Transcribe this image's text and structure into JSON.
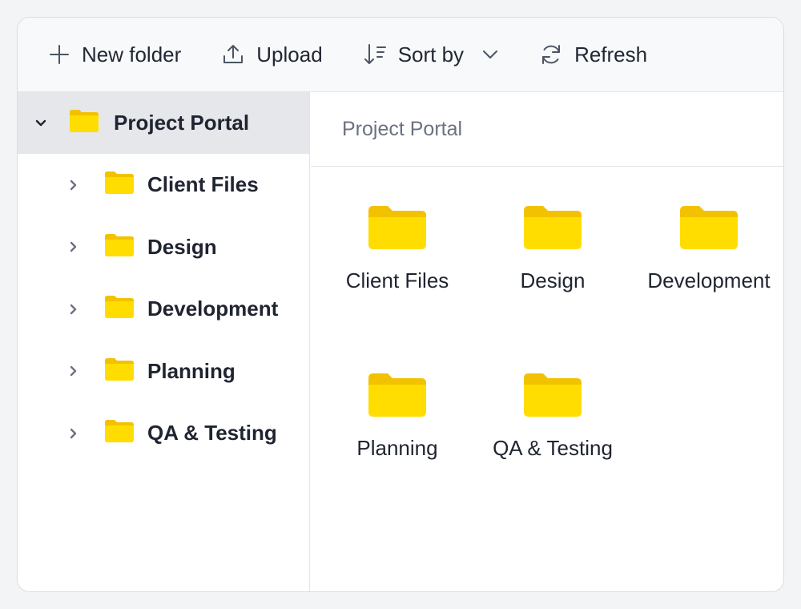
{
  "toolbar": {
    "new_folder_label": "New folder",
    "upload_label": "Upload",
    "sort_label": "Sort by",
    "refresh_label": "Refresh"
  },
  "tree": {
    "root_label": "Project Portal",
    "items": [
      {
        "label": "Client Files"
      },
      {
        "label": "Design"
      },
      {
        "label": "Development"
      },
      {
        "label": "Planning"
      },
      {
        "label": "QA & Testing"
      }
    ]
  },
  "main": {
    "breadcrumb": "Project Portal",
    "folders": [
      {
        "label": "Client Files"
      },
      {
        "label": "Design"
      },
      {
        "label": "Development"
      },
      {
        "label": "Planning"
      },
      {
        "label": "QA & Testing"
      }
    ]
  },
  "colors": {
    "folder_front": "#FFDD00",
    "folder_back": "#F2C200",
    "selected_row": "#E5E7EB"
  },
  "icons": {
    "new_folder": "plus-icon",
    "upload": "upload-icon",
    "sort": "sort-icon",
    "refresh": "refresh-icon",
    "folder": "folder-icon"
  }
}
